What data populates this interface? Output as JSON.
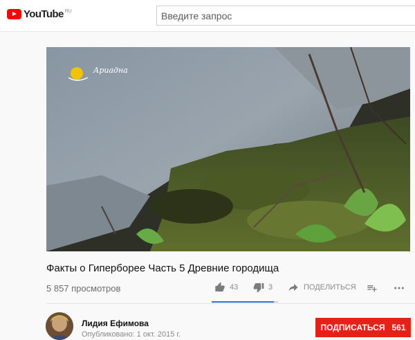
{
  "header": {
    "logo_text": "YouTube",
    "logo_region": "RU",
    "search_placeholder": "Введите запрос"
  },
  "video": {
    "watermark_text": "Ариадна",
    "title": "Факты о Гиперборее Часть 5 Древние городища",
    "views": "5 857 просмотров",
    "likes": "43",
    "dislikes": "3",
    "share_label": "ПОДЕЛИТЬСЯ",
    "like_ratio": 0.935
  },
  "channel": {
    "name": "Лидия Ефимова",
    "published": "Опубликовано: 1 окт. 2015 г.",
    "subscribe_label": "ПОДПИСАТЬСЯ",
    "subscriber_count": "561"
  },
  "colors": {
    "brand_red": "#ff0000",
    "subscribe_red": "#e62117",
    "sentiment_blue": "#2f6fd6"
  },
  "icons": [
    "play-logo-icon",
    "like-icon",
    "dislike-icon",
    "share-icon",
    "add-to-playlist-icon",
    "more-icon"
  ]
}
